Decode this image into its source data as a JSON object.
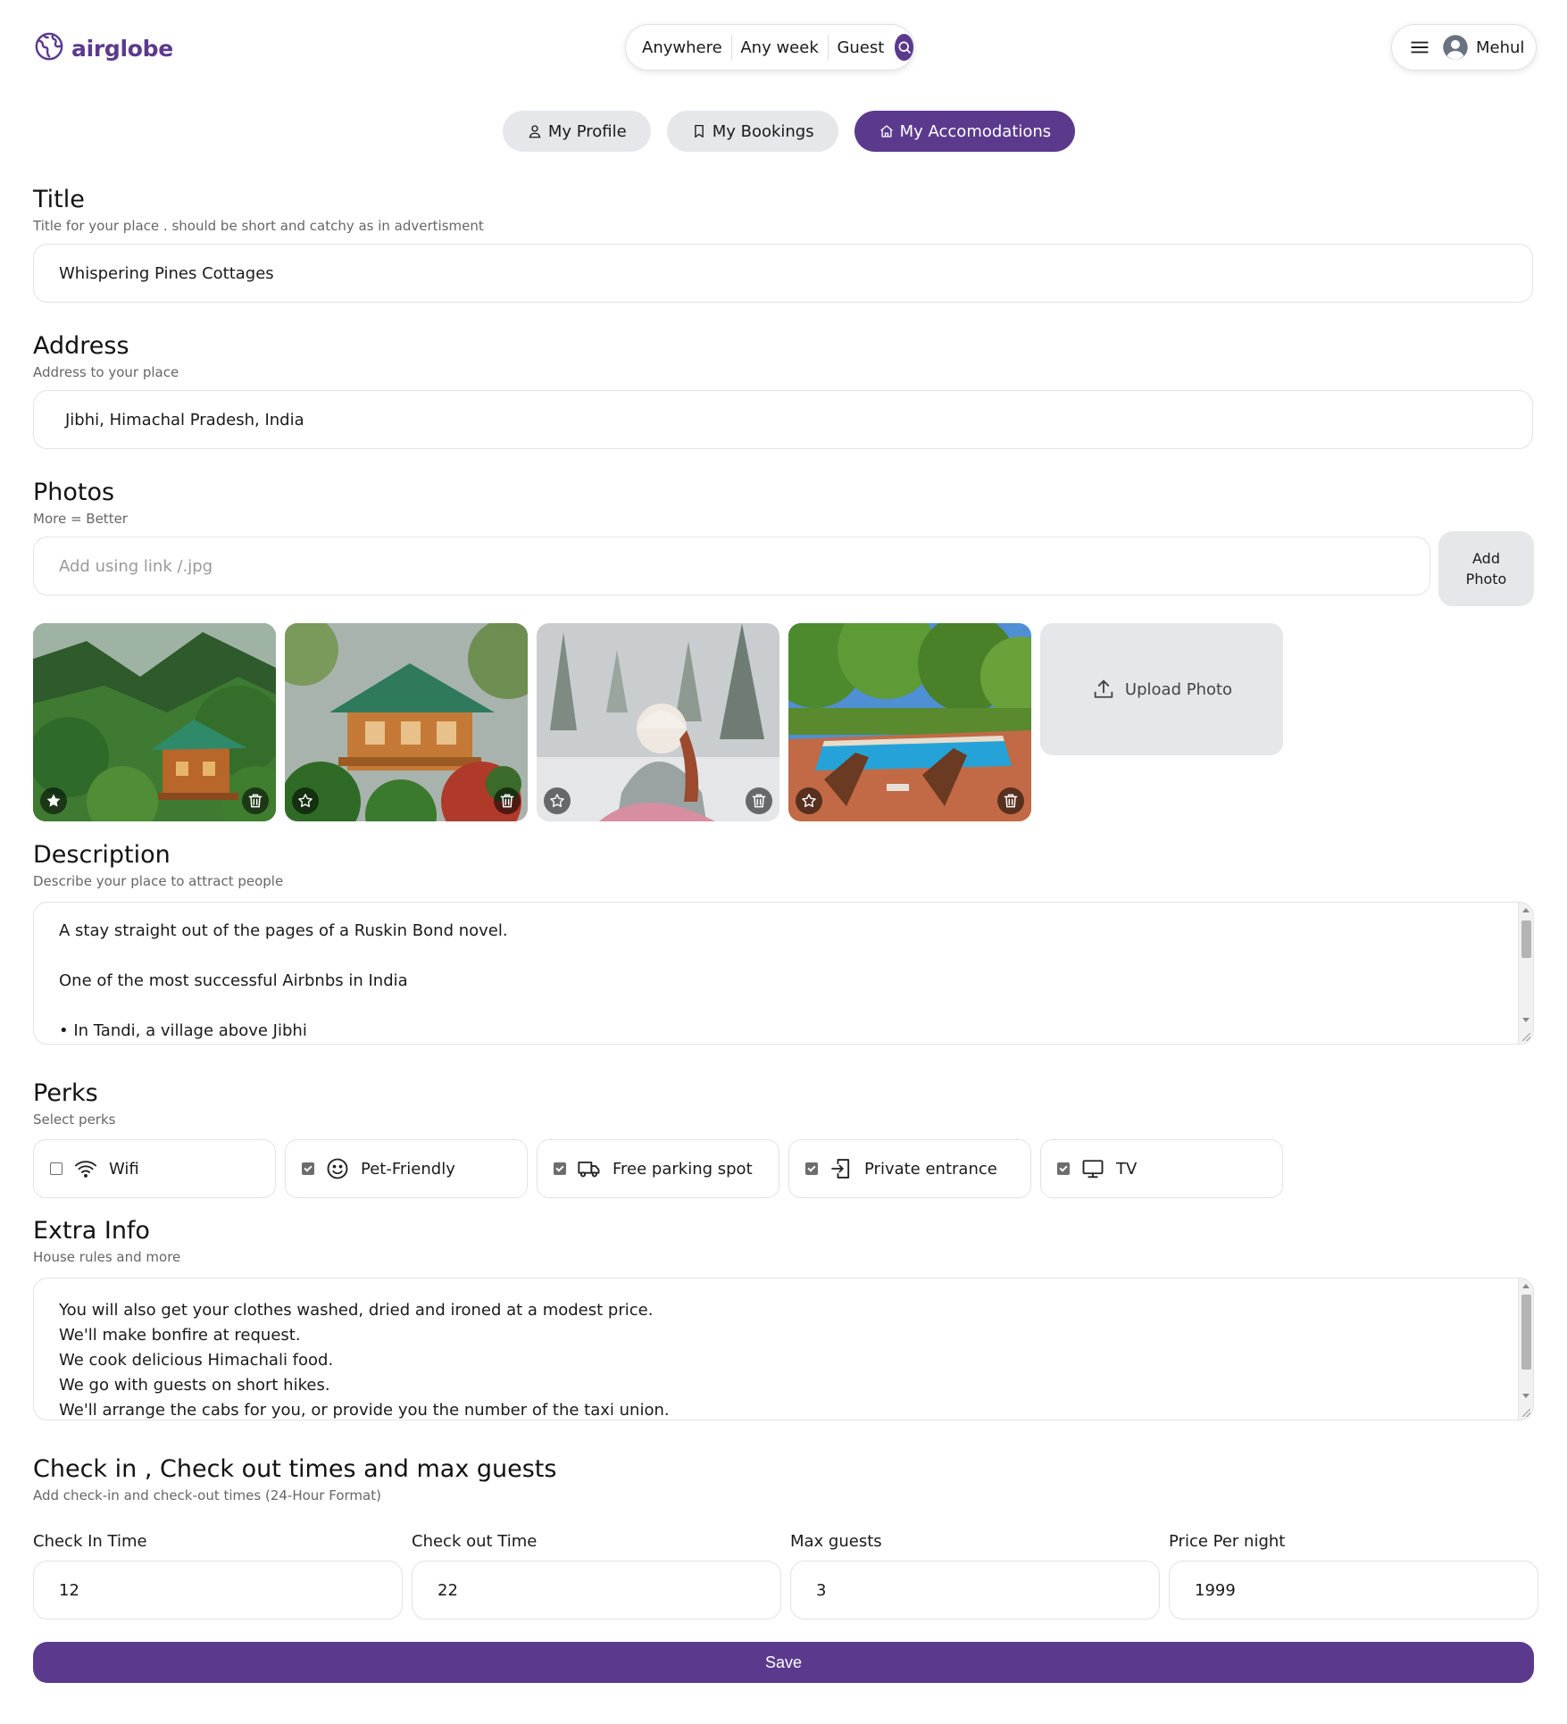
{
  "app": {
    "logo_text": "airglobe",
    "accent_color": "#5b3a8e"
  },
  "search": {
    "location": "Anywhere",
    "week": "Any week",
    "guests": "Guest"
  },
  "user": {
    "name": "Mehul"
  },
  "tabs": [
    {
      "label": "My Profile",
      "icon": "user-icon",
      "active": false
    },
    {
      "label": "My Bookings",
      "icon": "bookmark-icon",
      "active": false
    },
    {
      "label": "My Accomodations",
      "icon": "home-icon",
      "active": true
    }
  ],
  "title": {
    "heading": "Title",
    "hint": "Title for your place . should be short and catchy as in advertisment",
    "value": "Whispering Pines Cottages"
  },
  "address": {
    "heading": "Address",
    "hint": "Address to your place",
    "value": "Jibhi, Himachal Pradesh, India"
  },
  "photos": {
    "heading": "Photos",
    "hint": "More = Better",
    "link_placeholder": "Add using link /.jpg",
    "add_button": "Add Photo",
    "upload_label": "Upload Photo",
    "items": [
      {
        "subject": "wooden cottage in forest",
        "main": true
      },
      {
        "subject": "wooden cottage with garden",
        "main": false
      },
      {
        "subject": "woman in snowy forest",
        "main": false
      },
      {
        "subject": "swimming pool with lounge chairs",
        "main": false
      }
    ]
  },
  "description": {
    "heading": "Description",
    "hint": "Describe your place to attract people",
    "lines": [
      "A stay straight out of the pages of a Ruskin Bond novel.",
      "",
      "One of the most successful Airbnbs in India",
      "",
      "• In Tandi, a village above Jibhi"
    ]
  },
  "perks": {
    "heading": "Perks",
    "hint": "Select perks",
    "items": [
      {
        "label": "Wifi",
        "icon": "wifi-icon",
        "checked": false
      },
      {
        "label": "Pet-Friendly",
        "icon": "smile-icon",
        "checked": true
      },
      {
        "label": "Free parking spot",
        "icon": "truck-icon",
        "checked": true
      },
      {
        "label": "Private entrance",
        "icon": "door-enter-icon",
        "checked": true
      },
      {
        "label": "TV",
        "icon": "monitor-icon",
        "checked": true
      }
    ]
  },
  "extra_info": {
    "heading": "Extra Info",
    "hint": "House rules and more",
    "lines": [
      "You will also get your clothes washed, dried and ironed at a modest price.",
      "We'll make bonfire at request.",
      "We cook delicious Himachali food.",
      "We go with guests on short hikes.",
      "We'll arrange the cabs for you, or provide you the number of the taxi union."
    ]
  },
  "checkin": {
    "heading": "Check in , Check out times and max guests",
    "hint": "Add check-in and check-out times (24-Hour Format)",
    "fields": [
      {
        "label": "Check In Time",
        "value": "12"
      },
      {
        "label": "Check out Time",
        "value": "22"
      },
      {
        "label": "Max guests",
        "value": "3"
      },
      {
        "label": "Price Per night",
        "value": "1999"
      }
    ]
  },
  "save_label": "Save"
}
